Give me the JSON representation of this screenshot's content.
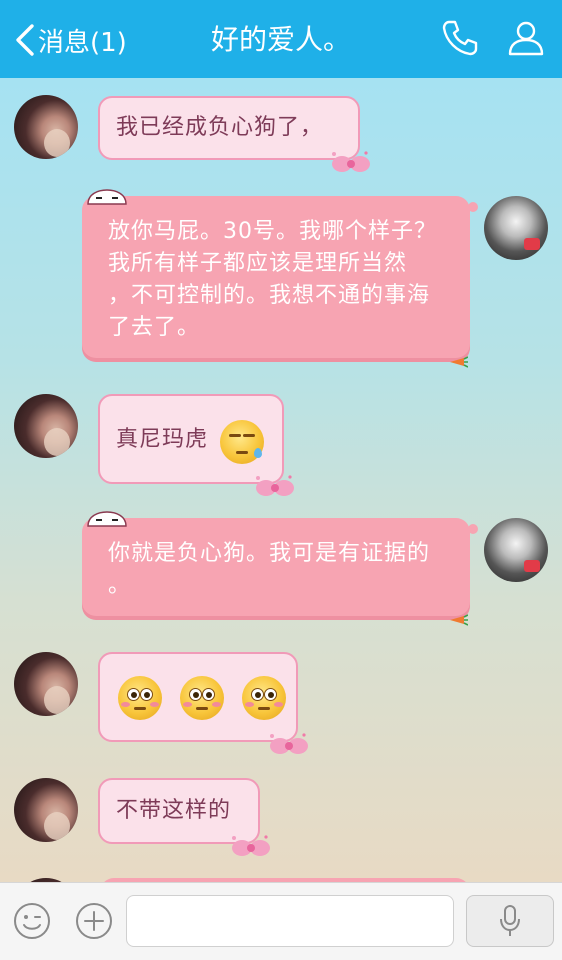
{
  "header": {
    "back_label": "消息(1)",
    "title": "好的爱人。",
    "back_icon": "chevron-left-icon",
    "call_icon": "phone-icon",
    "profile_icon": "person-icon"
  },
  "messages": [
    {
      "side": "left",
      "sender": "her",
      "text": "我已经成负心狗了，"
    },
    {
      "side": "right",
      "sender": "me",
      "lines": [
        "放你马屁。30号。我哪个样子？",
        "我所有样子都应该是理所当然",
        "，不可控制的。我想不通的事海",
        "了去了。"
      ]
    },
    {
      "side": "left",
      "sender": "her",
      "text": "真尼玛虎",
      "emoji": "tired-sweat-emoji"
    },
    {
      "side": "right",
      "sender": "me",
      "lines": [
        "你就是负心狗。我可是有证据的",
        "。"
      ]
    },
    {
      "side": "left",
      "sender": "her",
      "emojis": [
        "flushed-emoji",
        "flushed-emoji",
        "flushed-emoji"
      ]
    },
    {
      "side": "left",
      "sender": "her",
      "text": "不带这样的"
    }
  ],
  "footer": {
    "emoji_icon": "smiley-icon",
    "add_icon": "plus-icon",
    "voice_icon": "microphone-icon",
    "input_value": "",
    "input_placeholder": ""
  },
  "colors": {
    "header": "#1fb0e8",
    "bubble_left_fill": "#fbe1ea",
    "bubble_left_border": "#f19ab8",
    "bubble_left_text": "#7e3b58",
    "bubble_right_fill": "#f7a4b2"
  }
}
